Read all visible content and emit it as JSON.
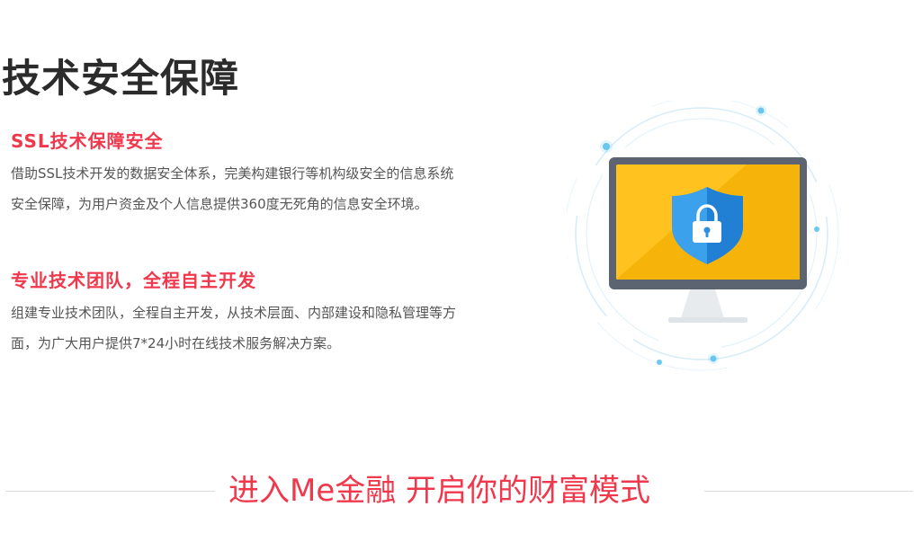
{
  "header": {
    "title": "技术安全保障"
  },
  "features": [
    {
      "title": "SSL技术保障安全",
      "description": "借助SSL技术开发的数据安全体系，完美构建银行等机构级安全的信息系统安全保障，为用户资金及个人信息提供360度无死角的信息安全环境。"
    },
    {
      "title": "专业技术团队，全程自主开发",
      "description": "组建专业技术团队，全程自主开发，从技术层面、内部建设和隐私管理等方面，为广大用户提供7*24小时在线技术服务解决方案。"
    }
  ],
  "illustration": {
    "icon": "secure-monitor-icon",
    "colors": {
      "monitor_frame": "#5b6470",
      "screen": "#ffc21f",
      "shield_light": "#3ba1ec",
      "shield_dark": "#2180d3",
      "orbit": "#cfe9f7",
      "dots": "#5cc3ee"
    }
  },
  "cta": {
    "label": "进入Me金融  开启你的财富模式"
  },
  "colors": {
    "accent": "#f0384c",
    "title": "#2b2b2b",
    "body_text": "#555555"
  }
}
